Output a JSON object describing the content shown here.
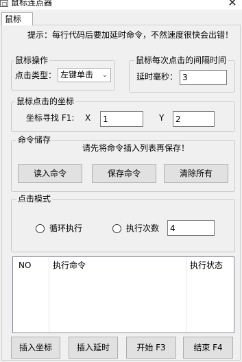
{
  "window": {
    "title": "鼠标连点器",
    "close_glyph": "✕"
  },
  "tab": {
    "label": "鼠标"
  },
  "hint": "提示：每行代码后要加延时命令，不然速度很快会出错！",
  "mouse_op": {
    "legend": "鼠标操作",
    "click_type_label": "点击类型：",
    "click_type_value": "左键单击"
  },
  "interval": {
    "legend": "鼠标每次点击的间隔时间",
    "delay_label": "延时毫秒：",
    "delay_value": "3"
  },
  "coords": {
    "legend": "鼠标点击的坐标",
    "find_label": "坐标寻找 F1:",
    "x_label": "X",
    "x_value": "1",
    "y_label": "Y",
    "y_value": "2"
  },
  "commands": {
    "legend": "命令储存",
    "note": "请先将命令插入列表再保存！",
    "read_button": "读入命令",
    "save_button": "保存命令",
    "clear_button": "清除所有"
  },
  "click_mode": {
    "legend": "点击模式",
    "loop_label": "循环执行",
    "times_label": "执行次数",
    "times_value": "4"
  },
  "table": {
    "columns": [
      "NO",
      "执行命令",
      "执行状态"
    ]
  },
  "bottom_buttons": {
    "insert_coord": "插入坐标",
    "insert_delay": "插入延时",
    "start": "开始  F3",
    "end": "结束  F4"
  }
}
